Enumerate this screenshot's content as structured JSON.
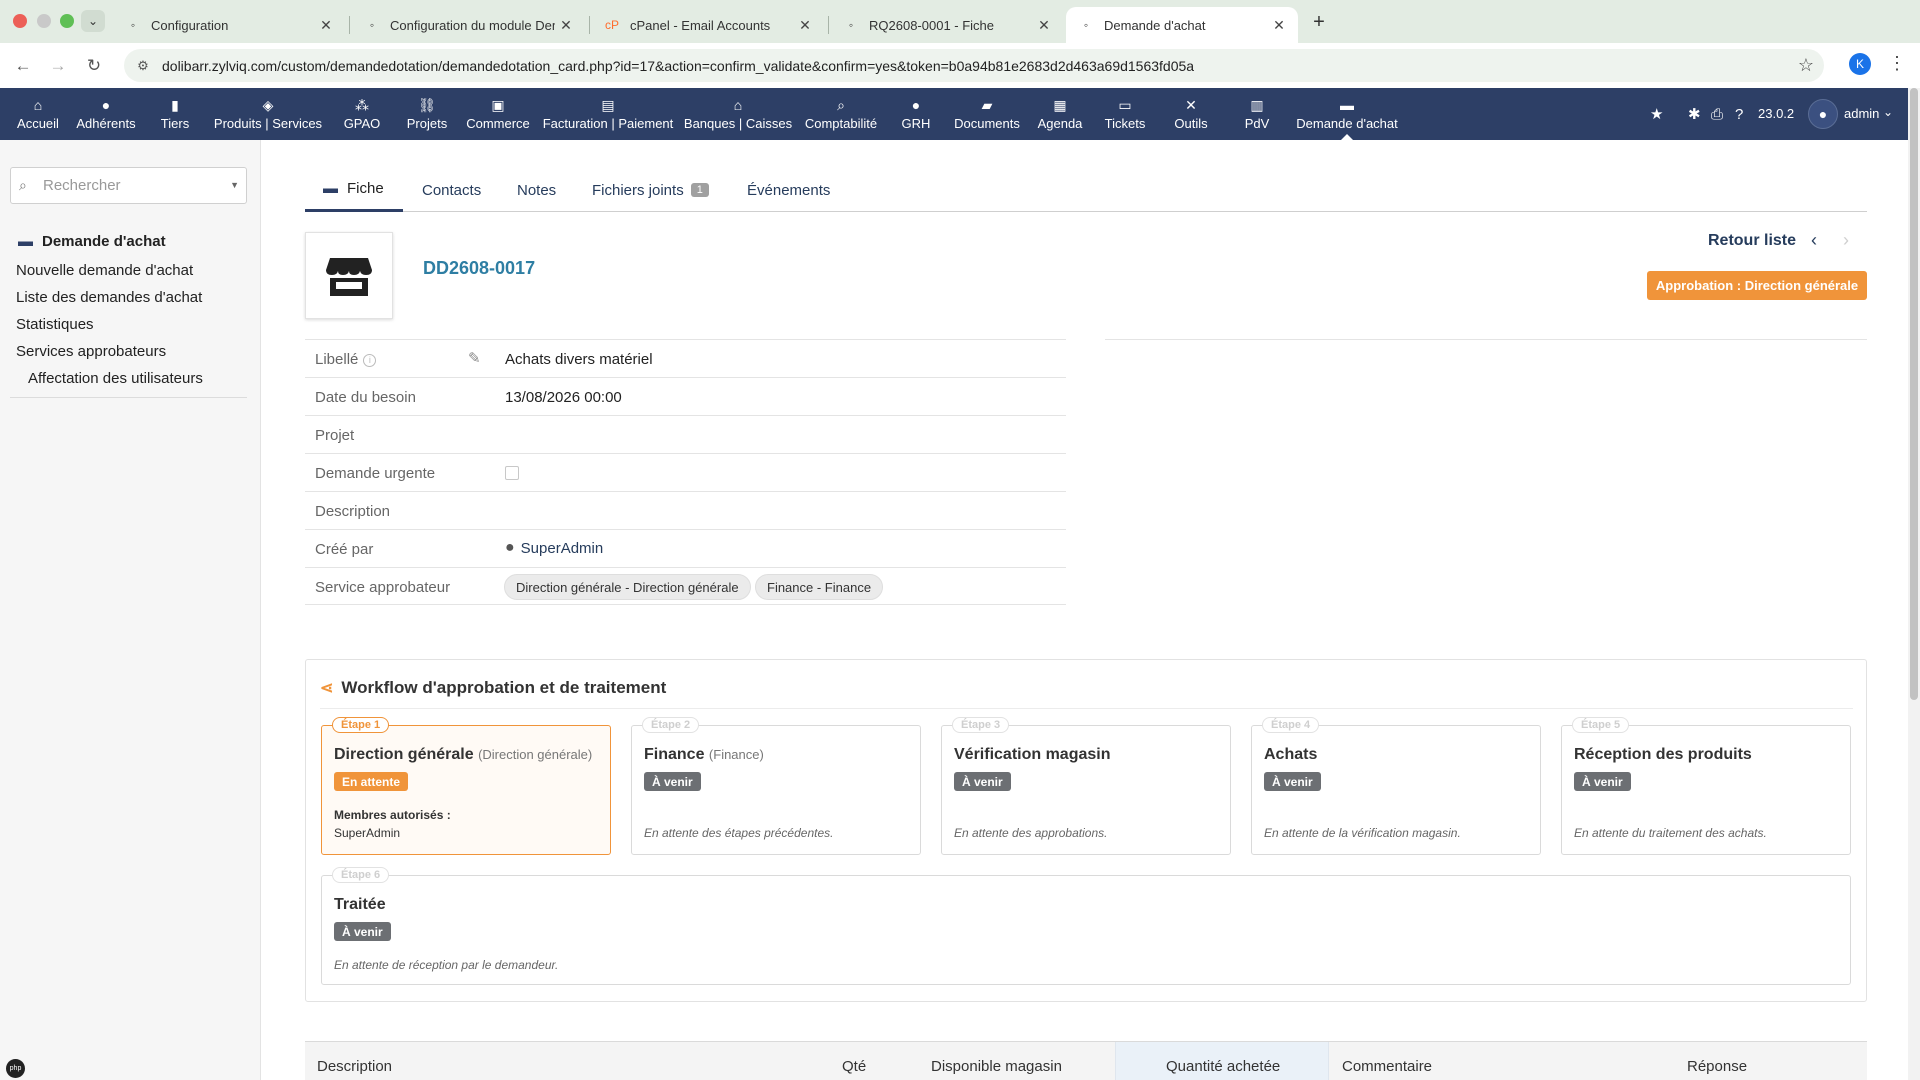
{
  "browser": {
    "tabs": [
      {
        "title": "Configuration",
        "icon": "page-icon"
      },
      {
        "title": "Configuration du module Dem",
        "icon": "page-icon"
      },
      {
        "title": "cPanel - Email Accounts",
        "icon": "cpanel-icon"
      },
      {
        "title": "RQ2608-0001 - Fiche",
        "icon": "page-icon"
      },
      {
        "title": "Demande d'achat",
        "icon": "page-icon"
      }
    ],
    "active_tab": 4,
    "url": "dolibarr.zylviq.com/custom/demandedotation/demandedotation_card.php?id=17&action=confirm_validate&confirm=yes&token=b0a94b81e2683d2d463a69d1563fd05a",
    "profile_initial": "K"
  },
  "topmenu": {
    "items": [
      {
        "label": "Accueil",
        "icon": "home-icon"
      },
      {
        "label": "Adhérents",
        "icon": "member-icon"
      },
      {
        "label": "Tiers",
        "icon": "building-icon"
      },
      {
        "label": "Produits | Services",
        "icon": "cube-icon"
      },
      {
        "label": "GPAO",
        "icon": "cubes-icon"
      },
      {
        "label": "Projets",
        "icon": "sitemap-icon"
      },
      {
        "label": "Commerce",
        "icon": "suitcase-icon"
      },
      {
        "label": "Facturation | Paiement",
        "icon": "invoice-icon"
      },
      {
        "label": "Banques | Caisses",
        "icon": "bank-icon"
      },
      {
        "label": "Comptabilité",
        "icon": "search-dollar-icon"
      },
      {
        "label": "GRH",
        "icon": "user-tie-icon"
      },
      {
        "label": "Documents",
        "icon": "folder-icon"
      },
      {
        "label": "Agenda",
        "icon": "calendar-icon"
      },
      {
        "label": "Tickets",
        "icon": "ticket-icon"
      },
      {
        "label": "Outils",
        "icon": "tools-icon"
      },
      {
        "label": "PdV",
        "icon": "cash-register-icon"
      },
      {
        "label": "Demande d'achat",
        "icon": "store-icon"
      }
    ],
    "version": "23.0.2",
    "user": "admin"
  },
  "sidebar": {
    "search_placeholder": "Rechercher",
    "heading": "Demande d'achat",
    "links": [
      "Nouvelle demande d'achat",
      "Liste des demandes d'achat",
      "Statistiques",
      "Services approbateurs",
      "Affectation des utilisateurs"
    ]
  },
  "tabs": {
    "fiche": "Fiche",
    "contacts": "Contacts",
    "notes": "Notes",
    "fichiers": "Fichiers joints",
    "fichiers_count": "1",
    "evenements": "Événements"
  },
  "record": {
    "ref": "DD2608-0017",
    "retour": "Retour liste",
    "status": "Approbation : Direction générale",
    "status_color": "#f0943a"
  },
  "fields": {
    "libelle_label": "Libellé",
    "libelle_value": "Achats divers matériel",
    "date_label": "Date du besoin",
    "date_value": "13/08/2026 00:00",
    "projet_label": "Projet",
    "urgente_label": "Demande urgente",
    "urgente_checked": false,
    "description_label": "Description",
    "cree_label": "Créé par",
    "cree_value": "SuperAdmin",
    "service_label": "Service approbateur",
    "services": [
      "Direction générale - Direction générale",
      "Finance - Finance"
    ]
  },
  "workflow": {
    "title": "Workflow d'approbation et de traitement",
    "steps": [
      {
        "label": "Étape 1",
        "name": "Direction générale",
        "sub": "(Direction générale)",
        "status": "En attente",
        "members_label": "Membres autorisés :",
        "members": "SuperAdmin"
      },
      {
        "label": "Étape 2",
        "name": "Finance",
        "sub": "(Finance)",
        "status": "À venir",
        "note": "En attente des étapes précédentes."
      },
      {
        "label": "Étape 3",
        "name": "Vérification magasin",
        "status": "À venir",
        "note": "En attente des approbations."
      },
      {
        "label": "Étape 4",
        "name": "Achats",
        "status": "À venir",
        "note": "En attente de la vérification magasin."
      },
      {
        "label": "Étape 5",
        "name": "Réception des produits",
        "status": "À venir",
        "note": "En attente du traitement des achats."
      },
      {
        "label": "Étape 6",
        "name": "Traitée",
        "status": "À venir",
        "note": "En attente de réception par le demandeur."
      }
    ]
  },
  "lines_table": {
    "columns": [
      "Description",
      "Qté",
      "Disponible magasin",
      "Quantité achetée",
      "Commentaire",
      "Réponse"
    ]
  }
}
